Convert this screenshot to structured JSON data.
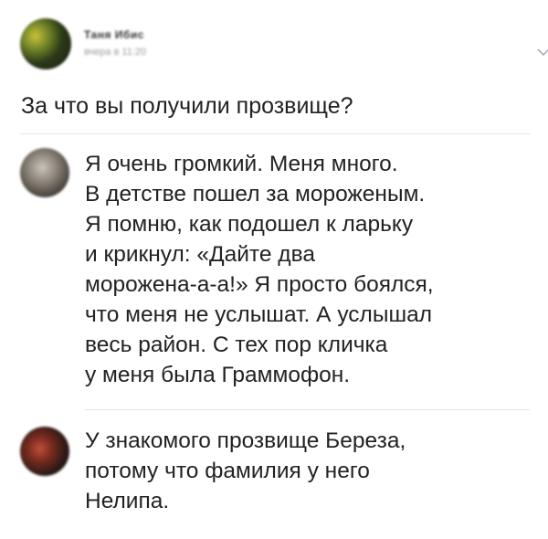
{
  "post": {
    "author_name": "Таня Ибис",
    "date": "вчера в 11:20",
    "question": "За что вы получили прозвище?"
  },
  "comments": [
    {
      "lines": [
        "Я очень громкий. Меня много.",
        "В детстве пошел за мороженым.",
        "Я помню, как подошел к ларьку",
        "и крикнул: «Дайте два",
        "морожена-а-а!» Я просто боялся,",
        "что меня не услышат. А услышал",
        "весь район. С тех пор кличка",
        "у меня была Граммофон."
      ]
    },
    {
      "lines": [
        "У знакомого прозвище Береза,",
        "потому что фамилия у него",
        "Нелипа."
      ]
    }
  ],
  "icons": {
    "expand": "chevron-down-icon"
  },
  "colors": {
    "text": "#222222",
    "divider": "#e3e5e8",
    "muted": "#9a9a9a"
  }
}
